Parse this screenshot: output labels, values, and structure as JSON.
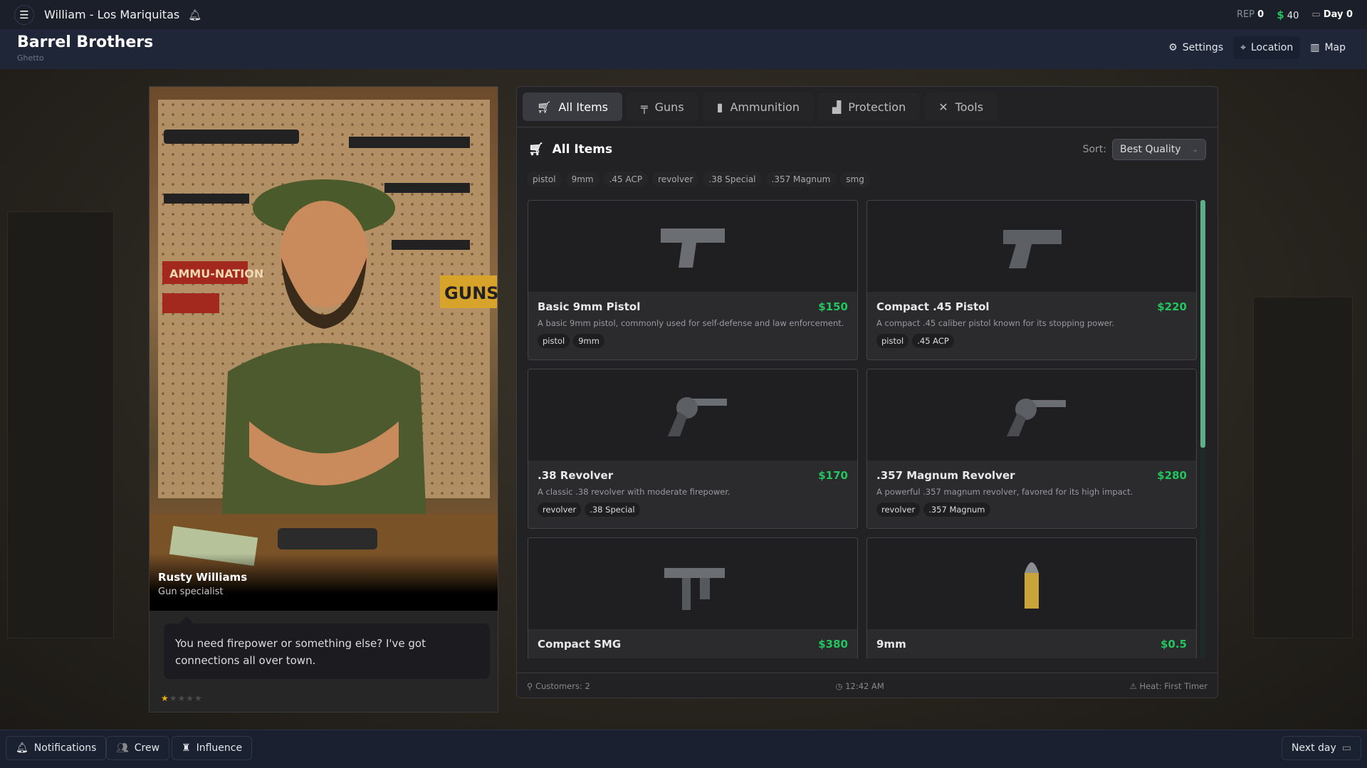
{
  "topbar": {
    "title": "William - Los Mariquitas",
    "rep_label": "REP",
    "rep_value": "0",
    "money": "40",
    "day": "Day 0"
  },
  "header": {
    "title": "Barrel Brothers",
    "subtitle": "Ghetto",
    "nav": [
      {
        "label": "Settings",
        "icon": "gear-icon"
      },
      {
        "label": "Location",
        "icon": "map-pin-icon"
      },
      {
        "label": "Map",
        "icon": "map-icon"
      }
    ]
  },
  "npc": {
    "name": "Rusty Williams",
    "role": "Gun specialist",
    "dialogue": "You need firepower or something else? I've got connections all over town.",
    "rating": 1,
    "rating_max": 5,
    "sign_ammu": "AMMU-NATION",
    "sign_guns": "GUNS"
  },
  "shop": {
    "tabs": [
      {
        "label": "All Items",
        "icon": "cart-icon"
      },
      {
        "label": "Guns",
        "icon": "gun-icon"
      },
      {
        "label": "Ammunition",
        "icon": "ammo-icon"
      },
      {
        "label": "Protection",
        "icon": "vest-icon"
      },
      {
        "label": "Tools",
        "icon": "tools-icon"
      }
    ],
    "section_title": "All Items",
    "sort_label": "Sort:",
    "sort_value": "Best Quality",
    "filters": [
      "pistol",
      "9mm",
      ".45 ACP",
      "revolver",
      ".38 Special",
      ".357 Magnum",
      "smg"
    ],
    "items": [
      {
        "name": "Basic 9mm Pistol",
        "price": "$150",
        "desc": "A basic 9mm pistol, commonly used for self-defense and law enforcement.",
        "tags": [
          "pistol",
          "9mm"
        ],
        "icon": "pistol-icon"
      },
      {
        "name": "Compact .45 Pistol",
        "price": "$220",
        "desc": "A compact .45 caliber pistol known for its stopping power.",
        "tags": [
          "pistol",
          ".45 ACP"
        ],
        "icon": "pistol-icon"
      },
      {
        "name": ".38 Revolver",
        "price": "$170",
        "desc": "A classic .38 revolver with moderate firepower.",
        "tags": [
          "revolver",
          ".38 Special"
        ],
        "icon": "revolver-icon"
      },
      {
        "name": ".357 Magnum Revolver",
        "price": "$280",
        "desc": "A powerful .357 magnum revolver, favored for its high impact.",
        "tags": [
          "revolver",
          ".357 Magnum"
        ],
        "icon": "revolver-icon"
      },
      {
        "name": "Compact SMG",
        "price": "$380",
        "icon": "smg-icon"
      },
      {
        "name": "9mm",
        "price": "$0.5",
        "icon": "bullet-icon"
      }
    ],
    "footer": {
      "customers": "Customers: 2",
      "time": "12:42 AM",
      "heat": "Heat: First Timer"
    }
  },
  "bottombar": {
    "notifications": "Notifications",
    "crew": "Crew",
    "influence": "Influence",
    "next_day": "Next day"
  },
  "colors": {
    "accent_green": "#22c55e",
    "scroll_thumb": "#5fae8a",
    "star": "#eab308"
  }
}
